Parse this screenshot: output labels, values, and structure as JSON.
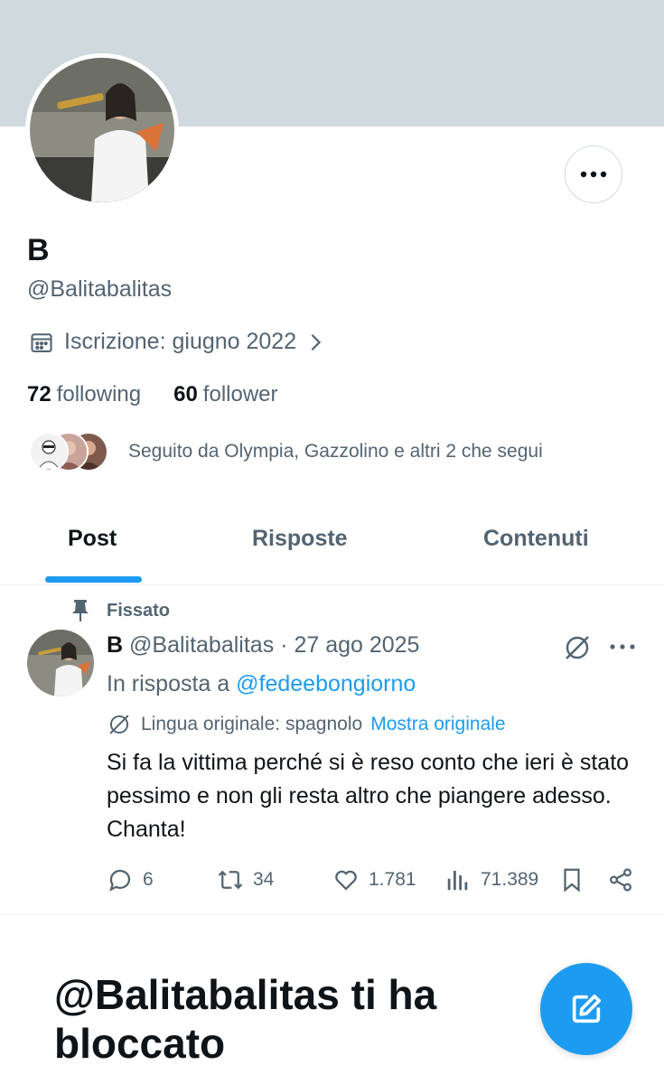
{
  "profile": {
    "display_name": "B",
    "handle": "@Balitabalitas",
    "joined": "Iscrizione: giugno 2022",
    "following_count": "72",
    "following_label": "following",
    "follower_count": "60",
    "follower_label": "follower",
    "followed_by": "Seguito da Olympia, Gazzolino e altri 2 che segui"
  },
  "tabs": [
    {
      "label": "Post",
      "active": true
    },
    {
      "label": "Risposte",
      "active": false
    },
    {
      "label": "Contenuti",
      "active": false
    }
  ],
  "pinned_tweet": {
    "pinned_label": "Fissato",
    "author_name": "B",
    "author_handle": "@Balitabalitas",
    "separator": "·",
    "date": "27 ago 2025",
    "reply_prefix": "In risposta a",
    "reply_mention": "@fedeebongiorno",
    "translation_note": "Lingua originale: spagnolo",
    "show_original": "Mostra originale",
    "text": "Si fa la vittima perché si è reso conto che ieri è stato pessimo e non gli resta altro che piangere adesso. Chanta!",
    "replies": "6",
    "reposts": "34",
    "likes": "1.781",
    "views": "71.389"
  },
  "blocked_message": "@Balitabalitas ti ha bloccato",
  "icons": {
    "more": "more-horizontal-icon",
    "calendar": "calendar-icon",
    "pin": "pin-icon",
    "grok": "grok-icon",
    "reply": "reply-icon",
    "repost": "repost-icon",
    "like": "heart-icon",
    "views": "views-chart-icon",
    "bookmark": "bookmark-icon",
    "share": "share-icon",
    "compose": "compose-icon"
  },
  "colors": {
    "accent": "#1d9bf0",
    "banner": "#cfd9de",
    "muted_text": "#536471",
    "primary_text": "#0f1419"
  }
}
